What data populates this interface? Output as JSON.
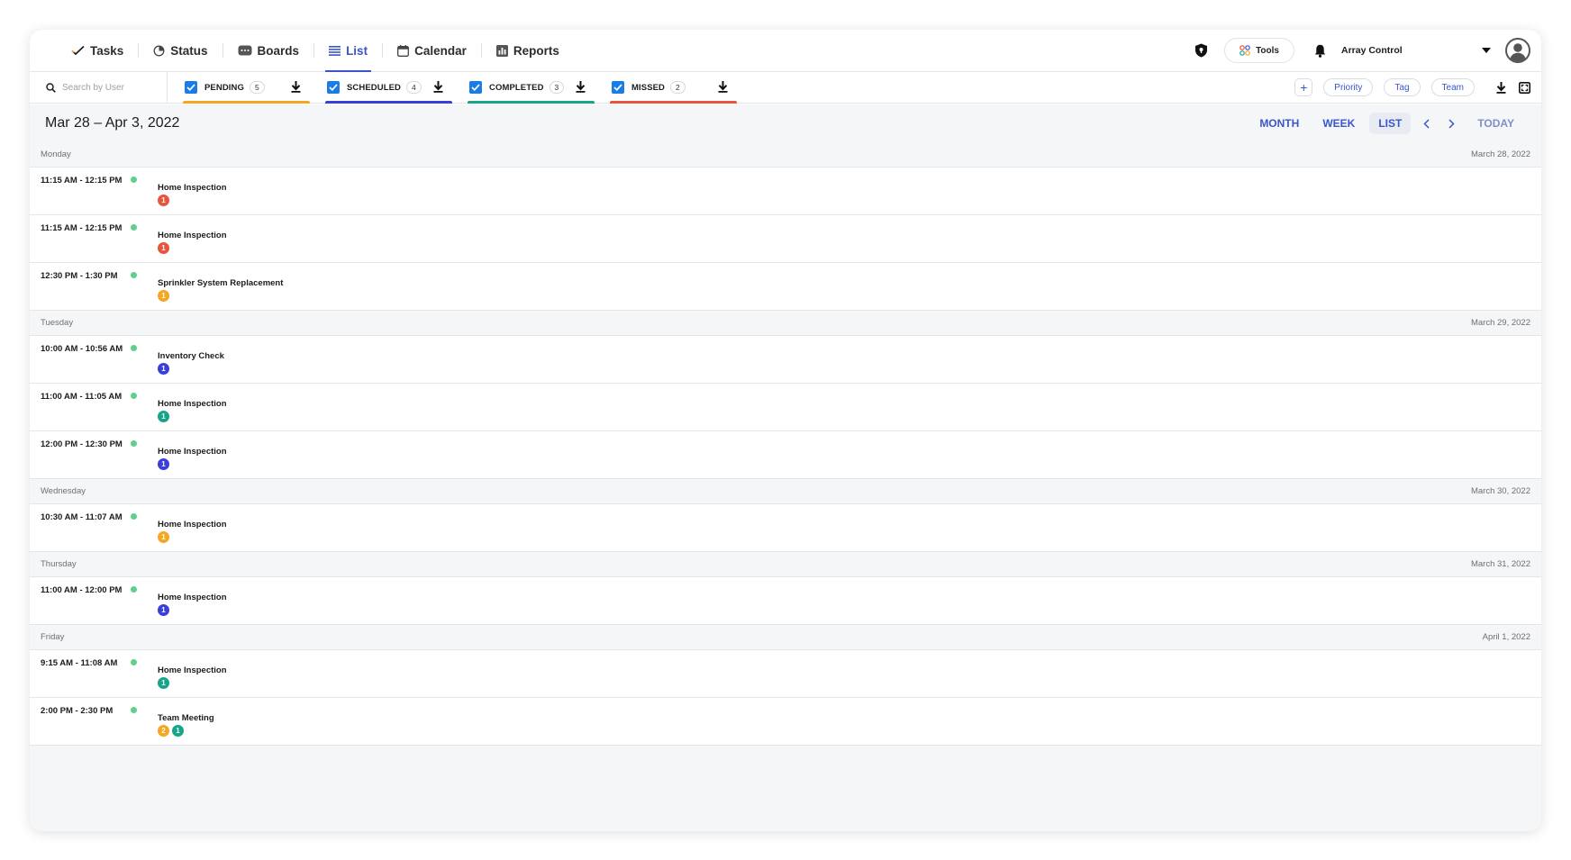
{
  "nav": {
    "items": [
      {
        "id": "tasks",
        "label": "Tasks",
        "icon": "check-icon"
      },
      {
        "id": "status",
        "label": "Status",
        "icon": "status-icon"
      },
      {
        "id": "boards",
        "label": "Boards",
        "icon": "boards-icon"
      },
      {
        "id": "list",
        "label": "List",
        "icon": "list-icon",
        "active": true
      },
      {
        "id": "calendar",
        "label": "Calendar",
        "icon": "calendar-icon"
      },
      {
        "id": "reports",
        "label": "Reports",
        "icon": "reports-icon"
      }
    ],
    "tools_label": "Tools",
    "account_name": "Array Control"
  },
  "filters": {
    "search_placeholder": "Search by User",
    "tabs": [
      {
        "label": "PENDING",
        "count": "5",
        "color": "#f5a623"
      },
      {
        "label": "SCHEDULED",
        "count": "4",
        "color": "#3a3fd9"
      },
      {
        "label": "COMPLETED",
        "count": "3",
        "color": "#17a589"
      },
      {
        "label": "MISSED",
        "count": "2",
        "color": "#e8553e"
      }
    ],
    "pills": [
      "Priority",
      "Tag",
      "Team"
    ]
  },
  "calendar": {
    "title": "Mar 28 – Apr 3, 2022",
    "views": [
      "MONTH",
      "WEEK",
      "LIST"
    ],
    "active_view": "LIST",
    "today_label": "TODAY",
    "days": [
      {
        "name": "Monday",
        "date": "March 28, 2022",
        "events": [
          {
            "time": "11:15 AM - 12:15 PM",
            "title": "Home Inspection",
            "badges": [
              {
                "n": "1",
                "color": "#e8553e"
              }
            ]
          },
          {
            "time": "11:15 AM - 12:15 PM",
            "title": "Home Inspection",
            "badges": [
              {
                "n": "1",
                "color": "#e8553e"
              }
            ]
          },
          {
            "time": "12:30 PM - 1:30 PM",
            "title": "Sprinkler System Replacement",
            "badges": [
              {
                "n": "1",
                "color": "#f5a623"
              }
            ]
          }
        ]
      },
      {
        "name": "Tuesday",
        "date": "March 29, 2022",
        "events": [
          {
            "time": "10:00 AM - 10:56 AM",
            "title": "Inventory Check",
            "badges": [
              {
                "n": "1",
                "color": "#3a3fd9"
              }
            ]
          },
          {
            "time": "11:00 AM - 11:05 AM",
            "title": "Home Inspection",
            "badges": [
              {
                "n": "1",
                "color": "#17a589"
              }
            ]
          },
          {
            "time": "12:00 PM - 12:30 PM",
            "title": "Home Inspection",
            "badges": [
              {
                "n": "1",
                "color": "#3a3fd9"
              }
            ]
          }
        ]
      },
      {
        "name": "Wednesday",
        "date": "March 30, 2022",
        "events": [
          {
            "time": "10:30 AM - 11:07 AM",
            "title": "Home Inspection",
            "badges": [
              {
                "n": "1",
                "color": "#f5a623"
              }
            ]
          }
        ]
      },
      {
        "name": "Thursday",
        "date": "March 31, 2022",
        "events": [
          {
            "time": "11:00 AM - 12:00 PM",
            "title": "Home Inspection",
            "badges": [
              {
                "n": "1",
                "color": "#3a3fd9"
              }
            ]
          }
        ]
      },
      {
        "name": "Friday",
        "date": "April 1, 2022",
        "events": [
          {
            "time": "9:15 AM - 11:08 AM",
            "title": "Home Inspection",
            "badges": [
              {
                "n": "1",
                "color": "#17a589"
              }
            ]
          },
          {
            "time": "2:00 PM - 2:30 PM",
            "title": "Team Meeting",
            "badges": [
              {
                "n": "2",
                "color": "#f5a623"
              },
              {
                "n": "1",
                "color": "#17a589"
              }
            ]
          }
        ]
      }
    ]
  }
}
